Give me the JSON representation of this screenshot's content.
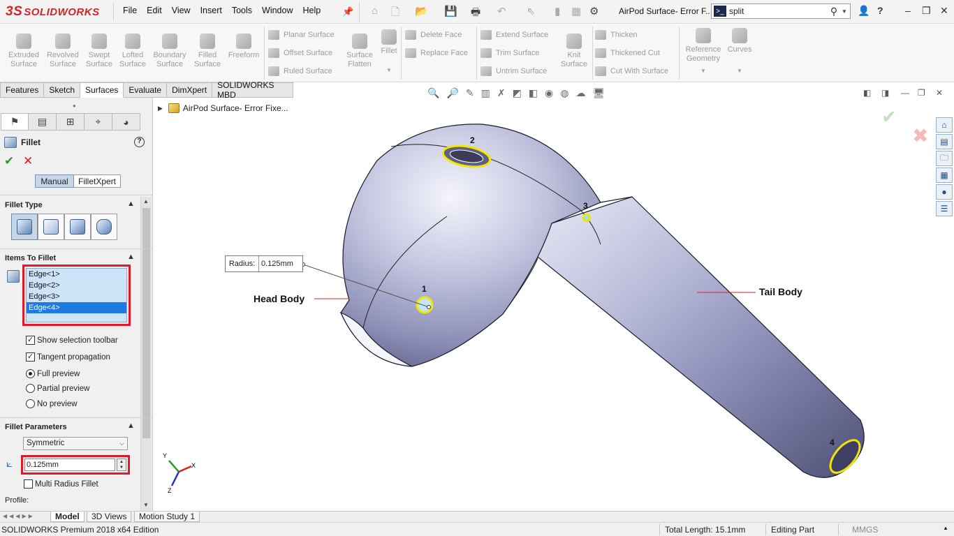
{
  "app": {
    "logo_ds": "3S",
    "logo_text": "SOLIDWORKS",
    "doc_title": "AirPod Surface- Error F...",
    "search_value": "split",
    "menu": [
      "File",
      "Edit",
      "View",
      "Insert",
      "Tools",
      "Window",
      "Help"
    ]
  },
  "commands": {
    "big": [
      "Extruded Surface",
      "Revolved Surface",
      "Swept Surface",
      "Lofted Surface",
      "Boundary Surface",
      "Filled Surface",
      "Freeform"
    ],
    "col1": [
      "Planar Surface",
      "Offset Surface",
      "Ruled Surface"
    ],
    "surface_flatten": "Surface Flatten",
    "fillet": "Fillet",
    "col2": [
      "Delete Face",
      "Replace Face"
    ],
    "col3": [
      "Extend Surface",
      "Trim Surface",
      "Untrim Surface"
    ],
    "knit": "Knit Surface",
    "col4": [
      "Thicken",
      "Thickened Cut",
      "Cut With Surface"
    ],
    "reference": "Reference Geometry",
    "curves": "Curves"
  },
  "tabs": [
    "Features",
    "Sketch",
    "Surfaces",
    "Evaluate",
    "DimXpert",
    "SOLIDWORKS MBD"
  ],
  "active_tab": "Surfaces",
  "property_manager": {
    "title": "Fillet",
    "mode_manual": "Manual",
    "mode_xpert": "FilletXpert",
    "fillet_type_label": "Fillet Type",
    "items_label": "Items To Fillet",
    "edges": [
      "Edge<1>",
      "Edge<2>",
      "Edge<3>",
      "Edge<4>"
    ],
    "selected_edge_index": 3,
    "show_selection_toolbar": "Show selection toolbar",
    "tangent_propagation": "Tangent propagation",
    "full_preview": "Full preview",
    "partial_preview": "Partial preview",
    "no_preview": "No preview",
    "params_label": "Fillet Parameters",
    "symmetric": "Symmetric",
    "radius_value": "0.125mm",
    "multi_radius": "Multi Radius Fillet",
    "profile_label": "Profile:"
  },
  "graphics": {
    "tree_node": "AirPod Surface- Error Fixe...",
    "radius_label": "Radius:",
    "radius_value": "0.125mm",
    "head_body": "Head Body",
    "tail_body": "Tail Body",
    "markers": [
      "1",
      "2",
      "3",
      "4"
    ],
    "triad": {
      "x": "X",
      "y": "Y",
      "z": "Z"
    }
  },
  "bottom_tabs": [
    "Model",
    "3D Views",
    "Motion Study 1"
  ],
  "status": {
    "edition": "SOLIDWORKS Premium 2018 x64 Edition",
    "total_length": "Total Length: 15.1mm",
    "editing": "Editing Part",
    "units": "MMGS"
  },
  "colors": {
    "accent_red": "#e01a2a",
    "selection_blue": "#1e7ae0",
    "highlight_yellow": "#f2e600"
  }
}
